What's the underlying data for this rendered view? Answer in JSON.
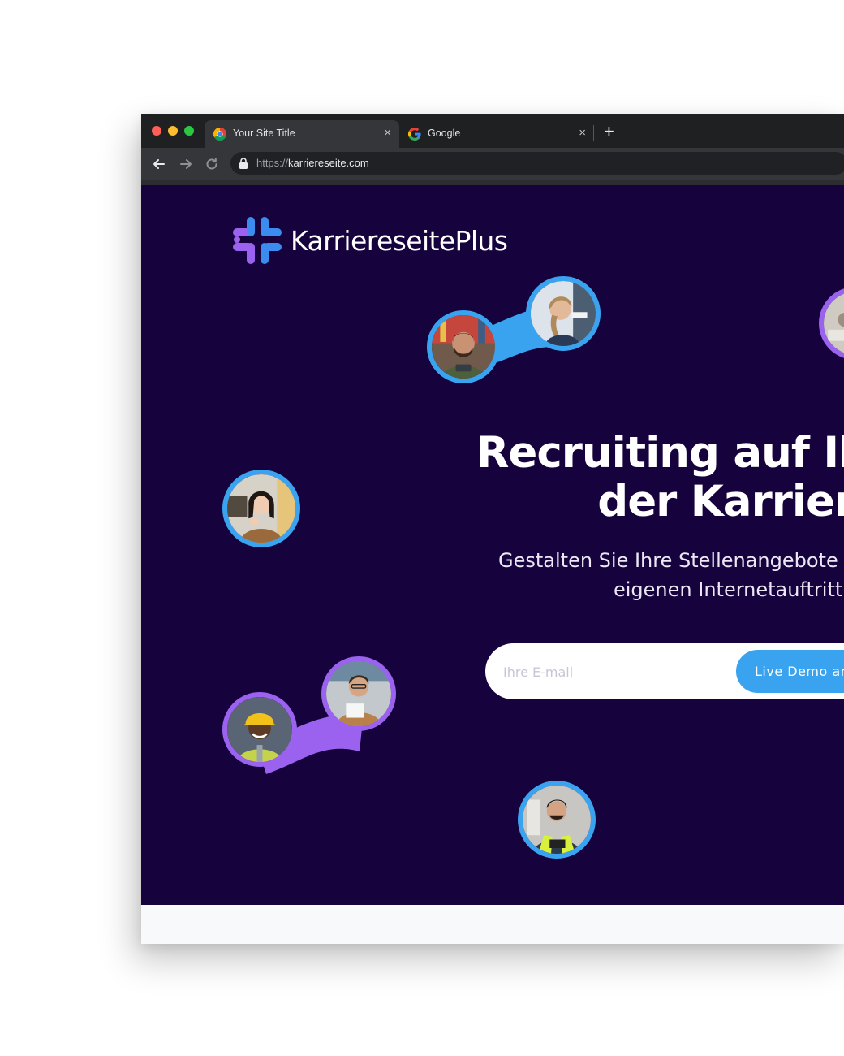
{
  "browser": {
    "tabs": [
      {
        "label": "Your Site Title",
        "active": true,
        "favicon": "chrome-icon"
      },
      {
        "label": "Google",
        "active": false,
        "favicon": "google-icon"
      }
    ],
    "new_tab_label": "+",
    "close_glyph": "×",
    "address": {
      "scheme": "https://",
      "host": "karriereseite.com"
    }
  },
  "hero": {
    "logo_text": "KarriereseitePlus",
    "headline_line1": "Recruiting auf Ihrer W",
    "headline_line2": "der Karriereseite",
    "subhead_line1": "Gestalten Sie Ihre Stellenangebote",
    "subhead_line2": "eigenen Internetauftritt",
    "email_placeholder": "Ihre E-mail",
    "cta_label": "Live Demo an"
  },
  "colors": {
    "hero_bg": "#16033d",
    "accent_blue": "#3aa3f0",
    "accent_purple": "#9a62ee",
    "logo_blue": "#3c8cf0",
    "logo_purple": "#9a62ee"
  },
  "icons": [
    "back-arrow-icon",
    "forward-arrow-icon",
    "reload-icon",
    "lock-icon",
    "close-icon",
    "plus-icon"
  ]
}
